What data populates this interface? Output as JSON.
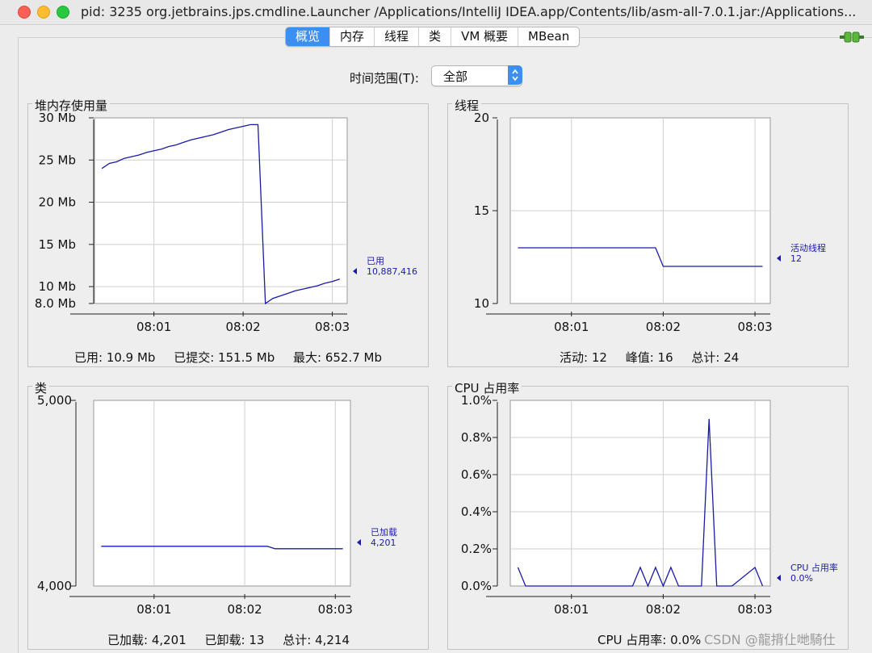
{
  "window": {
    "title": "pid: 3235 org.jetbrains.jps.cmdline.Launcher /Applications/IntelliJ IDEA.app/Contents/lib/asm-all-7.0.1.jar:/Applications..."
  },
  "tabs": [
    "概览",
    "内存",
    "线程",
    "类",
    "VM 概要",
    "MBean"
  ],
  "active_tab": "概览",
  "time_range": {
    "label": "时间范围(T):",
    "value": "全部"
  },
  "panels": {
    "heap": {
      "title": "堆内存使用量",
      "footer": [
        "已用: 10.9 Mb",
        "已提交: 151.5 Mb",
        "最大: 652.7 Mb"
      ]
    },
    "threads": {
      "title": "线程",
      "footer": [
        "活动: 12",
        "峰值: 16",
        "总计: 24"
      ]
    },
    "classes": {
      "title": "类",
      "footer": [
        "已加载: 4,201",
        "已卸载: 13",
        "总计: 4,214"
      ]
    },
    "cpu": {
      "title": "CPU 占用率",
      "footer": [
        "CPU 占用率: 0.0%"
      ]
    }
  },
  "watermark": "CSDN @龍揹仩哋騎仕",
  "colors": {
    "line": "#1a1aa6",
    "accent": "#3b8ff0",
    "grid": "#cfcfcf"
  },
  "chart_data": [
    {
      "id": "heap",
      "type": "line",
      "title": "堆内存使用量",
      "x_ticks": [
        "08:01",
        "08:02",
        "08:03"
      ],
      "y_ticks": [
        "30 Mb",
        "25 Mb",
        "20 Mb",
        "15 Mb",
        "10 Mb",
        "8.0 Mb"
      ],
      "ylim": [
        8,
        30
      ],
      "legend": {
        "name": "已用",
        "value": "10,887,416"
      },
      "series": [
        {
          "name": "已用",
          "x": [
            "08:00:25",
            "08:00:30",
            "08:00:35",
            "08:00:40",
            "08:00:45",
            "08:00:50",
            "08:00:55",
            "08:01:00",
            "08:01:05",
            "08:01:10",
            "08:01:15",
            "08:01:20",
            "08:01:25",
            "08:01:30",
            "08:01:35",
            "08:01:40",
            "08:01:45",
            "08:01:50",
            "08:01:55",
            "08:02:00",
            "08:02:05",
            "08:02:10",
            "08:02:15",
            "08:02:20",
            "08:02:25",
            "08:02:30",
            "08:02:35",
            "08:02:40",
            "08:02:45",
            "08:02:50",
            "08:02:55",
            "08:03:00",
            "08:03:05"
          ],
          "y": [
            24,
            24.6,
            24.8,
            25.2,
            25.4,
            25.6,
            25.9,
            26.1,
            26.3,
            26.6,
            26.8,
            27.1,
            27.4,
            27.6,
            27.8,
            28.0,
            28.3,
            28.6,
            28.8,
            29.0,
            29.2,
            29.2,
            8.0,
            8.6,
            8.9,
            9.2,
            9.5,
            9.7,
            9.9,
            10.1,
            10.4,
            10.6,
            10.9
          ]
        }
      ]
    },
    {
      "id": "threads",
      "type": "line",
      "title": "线程",
      "x_ticks": [
        "08:01",
        "08:02",
        "08:03"
      ],
      "y_ticks": [
        "20",
        "15",
        "10"
      ],
      "ylim": [
        10,
        20
      ],
      "legend": {
        "name": "活动线程",
        "value": "12"
      },
      "series": [
        {
          "name": "活动线程",
          "x": [
            "08:00:25",
            "08:01:55",
            "08:02:00",
            "08:03:05"
          ],
          "y": [
            13,
            13,
            12,
            12
          ]
        }
      ]
    },
    {
      "id": "classes",
      "type": "line",
      "title": "类",
      "x_ticks": [
        "08:01",
        "08:02",
        "08:03"
      ],
      "y_ticks": [
        "5,000",
        "4,000"
      ],
      "ylim": [
        4000,
        5000
      ],
      "legend": {
        "name": "已加载",
        "value": "4,201"
      },
      "series": [
        {
          "name": "已加载",
          "x": [
            "08:00:25",
            "08:02:15",
            "08:02:20",
            "08:03:05"
          ],
          "y": [
            4214,
            4214,
            4201,
            4201
          ]
        }
      ]
    },
    {
      "id": "cpu",
      "type": "line",
      "title": "CPU 占用率",
      "x_ticks": [
        "08:01",
        "08:02",
        "08:03"
      ],
      "y_ticks": [
        "1.0%",
        "0.8%",
        "0.6%",
        "0.4%",
        "0.2%",
        "0.0%"
      ],
      "ylim": [
        0,
        1.0
      ],
      "legend": {
        "name": "CPU 占用率",
        "value": "0.0%"
      },
      "series": [
        {
          "name": "CPU 占用率",
          "x": [
            "08:00:25",
            "08:00:30",
            "08:01:40",
            "08:01:45",
            "08:01:50",
            "08:01:55",
            "08:02:00",
            "08:02:05",
            "08:02:10",
            "08:02:15",
            "08:02:25",
            "08:02:30",
            "08:02:35",
            "08:02:40",
            "08:02:45",
            "08:03:00",
            "08:03:05"
          ],
          "y": [
            0.1,
            0,
            0,
            0.1,
            0,
            0.1,
            0,
            0.1,
            0,
            0,
            0,
            0.9,
            0,
            0,
            0,
            0.1,
            0
          ]
        }
      ]
    }
  ]
}
